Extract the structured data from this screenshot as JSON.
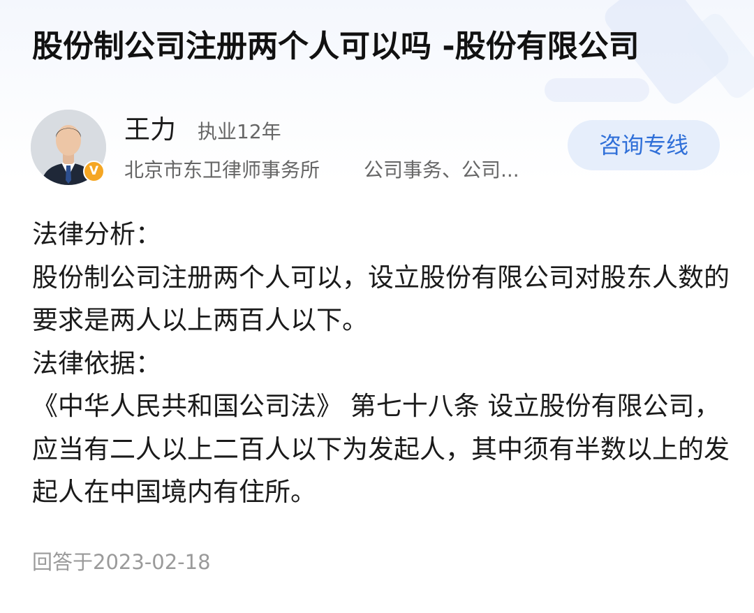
{
  "title": "股份制公司注册两个人可以吗 -股份有限公司",
  "lawyer": {
    "name": "王力",
    "experience": "执业12年",
    "firm": "北京市东卫律师事务所",
    "specialty": "公司事务、公司...",
    "verified_mark": "V",
    "avatar_icon": "lawyer-portrait",
    "verified_color": "#f5a623"
  },
  "consult_button": {
    "label": "咨询专线",
    "text_color": "#2f6fd8",
    "background": "#e6eefb"
  },
  "answer": {
    "paragraphs": [
      "法律分析：",
      "股份制公司注册两个人可以，设立股份有限公司对股东人数的要求是两人以上两百人以下。",
      "法律依据：",
      "《中华人民共和国公司法》 第七十八条 设立股份有限公司，应当有二人以上二百人以下为发起人，其中须有半数以上的发起人在中国境内有住所。"
    ]
  },
  "answered_at": "回答于2023-02-18"
}
